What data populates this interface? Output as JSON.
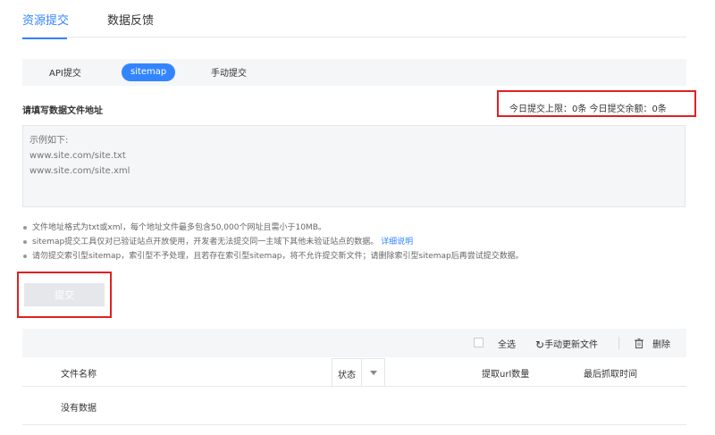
{
  "top_tabs": [
    {
      "label": "资源提交",
      "active": true
    },
    {
      "label": "数据反馈",
      "active": false
    }
  ],
  "sub_tabs": [
    {
      "label": "API提交",
      "active": false
    },
    {
      "label": "sitemap",
      "active": true
    },
    {
      "label": "手动提交",
      "active": false
    }
  ],
  "form": {
    "title": "请填写数据文件地址",
    "quota_text": "今日提交上限：0条   今日提交余额：0条",
    "placeholder": "示例如下:\nwww.site.com/site.txt\nwww.site.com/site.xml"
  },
  "notes": [
    "文件地址格式为txt或xml，每个地址文件最多包含50,000个网址且需小于10MB。",
    "sitemap提交工具仅对已验证站点开放使用，开发者无法提交同一主域下其他未验证站点的数据。",
    "请勿提交索引型sitemap，索引型不予处理，且若存在索引型sitemap，将不允许提交新文件；请删除索引型sitemap后再尝试提交数据。"
  ],
  "notes_link": "详细说明",
  "submit_label": "提交",
  "toolbar": {
    "select_all": "全选",
    "refresh": "手动更新文件",
    "delete": "删除"
  },
  "table": {
    "col_filename": "文件名称",
    "col_status": "状态",
    "col_url_count": "提取url数量",
    "col_last_crawl": "最后抓取时间",
    "empty_text": "没有数据"
  },
  "colors": {
    "accent": "#3385ff",
    "highlight": "#e02020"
  }
}
